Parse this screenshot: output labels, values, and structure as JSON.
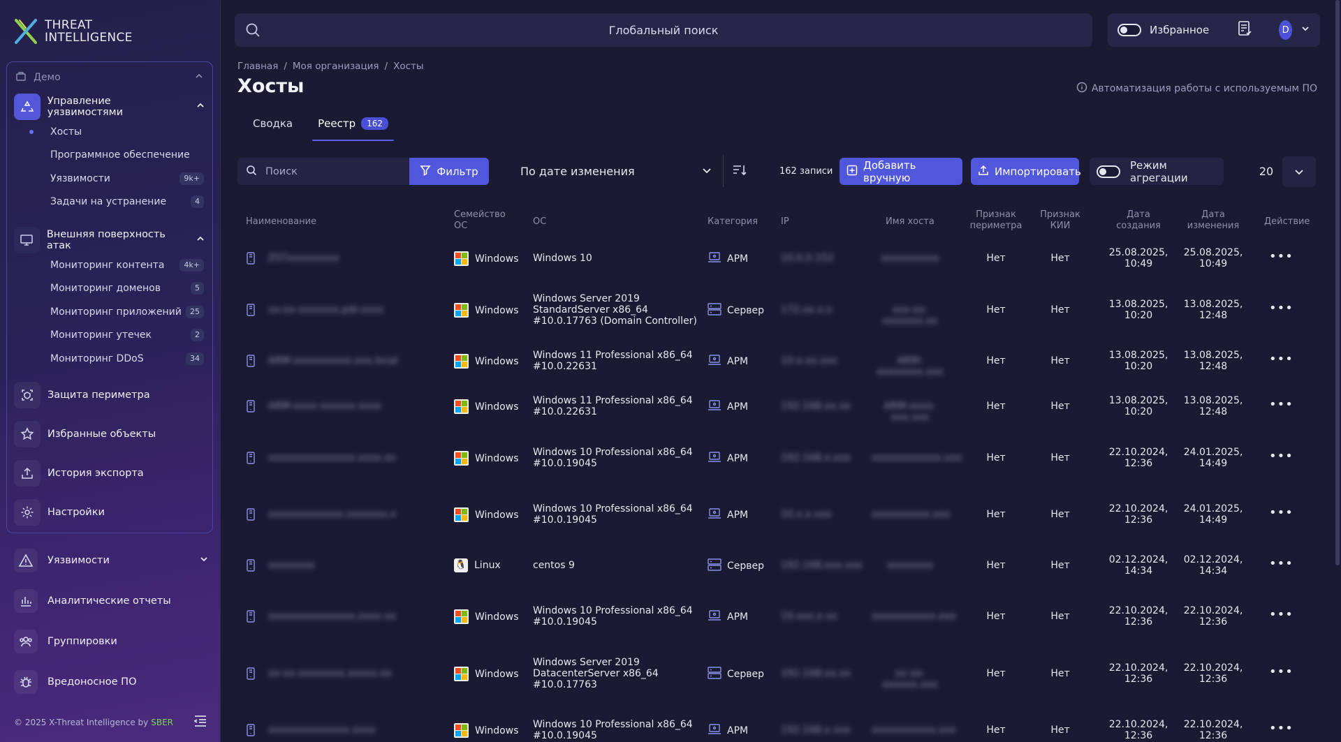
{
  "app": {
    "logo_line1": "THREAT",
    "logo_line2": "INTELLIGENCE",
    "footer_copyright": "© 2025 X-Threat Intelligence by",
    "footer_brand": "SBER"
  },
  "sidebar": {
    "org_label": "Демо",
    "groups": [
      {
        "label": "Управление уязвимостями",
        "items": [
          {
            "label": "Хосты",
            "badge": ""
          },
          {
            "label": "Программное обеспечение",
            "badge": ""
          },
          {
            "label": "Уязвимости",
            "badge": "9k+"
          },
          {
            "label": "Задачи на устранение",
            "badge": "4"
          }
        ]
      },
      {
        "label": "Внешняя поверхность атак",
        "items": [
          {
            "label": "Мониторинг контента",
            "badge": "4k+"
          },
          {
            "label": "Мониторинг доменов",
            "badge": "5"
          },
          {
            "label": "Мониторинг приложений",
            "badge": "25"
          },
          {
            "label": "Мониторинг утечек",
            "badge": "2"
          },
          {
            "label": "Мониторинг DDoS",
            "badge": "34"
          }
        ]
      }
    ],
    "inner_items": [
      "Защита периметра",
      "Избранные объекты",
      "История экспорта",
      "Настройки"
    ],
    "outer_items": [
      "Уязвимости",
      "Аналитические отчеты",
      "Группировки",
      "Вредоносное ПО"
    ]
  },
  "topbar": {
    "global_search": "Глобальный поиск",
    "favorites_label": "Избранное",
    "avatar_letter": "D"
  },
  "page": {
    "breadcrumb": [
      "Главная",
      "/",
      "Моя организация",
      "/",
      "Хосты"
    ],
    "title": "Хосты",
    "automation_link": "Автоматизация работы с используемым ПО",
    "tabs": [
      {
        "label": "Сводка"
      },
      {
        "label": "Реестр",
        "badge": "162"
      }
    ]
  },
  "toolbar": {
    "search_placeholder": "Поиск",
    "filter_label": "Фильтр",
    "sort_label": "По дате изменения",
    "records": "162 записи",
    "add_manual": "Добавить вручную",
    "import": "Импортировать",
    "aggregation": "Режим агрегации",
    "page_size": "20"
  },
  "table": {
    "headers": {
      "name": "Наименование",
      "os_family_1": "Семейство",
      "os_family_2": "ОС",
      "os": "ОС",
      "category": "Категория",
      "ip": "IP",
      "hostname": "Имя хоста",
      "perimeter_1": "Признак",
      "perimeter_2": "периметра",
      "kii_1": "Признак",
      "kii_2": "КИИ",
      "created_1": "Дата",
      "created_2": "создания",
      "modified_1": "Дата",
      "modified_2": "изменения",
      "action": "Действие"
    },
    "rows": [
      {
        "name": "ZSTxxxxxxxxx",
        "os_family": "Windows",
        "os_lines": [
          "Windows 10"
        ],
        "category": "АРМ",
        "ip": "10.0.0.152",
        "hostname": "xxxxxxxxxx",
        "perimeter": "Нет",
        "kii": "Нет",
        "created": [
          "25.08.2025,",
          "10:49"
        ],
        "modified": [
          "25.08.2025,",
          "10:49"
        ]
      },
      {
        "name": "xx-xx-xxxxxxx.pdr.xxxx",
        "os_family": "Windows",
        "os_lines": [
          "Windows Server 2019",
          "StandardServer x86_64",
          "#10.0.17763 (Domain Controller)"
        ],
        "category": "Сервер",
        "ip": "172.xx.x.x",
        "hostname": "xxx-xx-xxxxxxx.xx",
        "perimeter": "Нет",
        "kii": "Нет",
        "created": [
          "13.08.2025,",
          "10:20"
        ],
        "modified": [
          "13.08.2025,",
          "12:48"
        ]
      },
      {
        "name": "ARM-xxxxxxxxxx.xxx.local",
        "os_family": "Windows",
        "os_lines": [
          "Windows 11 Professional x86_64",
          "#10.0.22631"
        ],
        "category": "АРМ",
        "ip": "10.x.xx.xxx",
        "hostname": "ARM-xxxxxxxx.xxx",
        "perimeter": "Нет",
        "kii": "Нет",
        "created": [
          "13.08.2025,",
          "10:20"
        ],
        "modified": [
          "13.08.2025,",
          "12:48"
        ]
      },
      {
        "name": "ARM-xxxx-xxxxxx.xxxx",
        "os_family": "Windows",
        "os_lines": [
          "Windows 11 Professional x86_64",
          "#10.0.22631"
        ],
        "category": "АРМ",
        "ip": "192.168.xx.xx",
        "hostname": "ARM-xxxx-xxx.xxx",
        "perimeter": "Нет",
        "kii": "Нет",
        "created": [
          "13.08.2025,",
          "10:20"
        ],
        "modified": [
          "13.08.2025,",
          "12:48"
        ]
      },
      {
        "name": "xxxxxxxxxxxxxxx.xxxx.xx",
        "os_family": "Windows",
        "os_lines": [
          "Windows 10 Professional x86_64",
          "#10.0.19045"
        ],
        "category": "АРМ",
        "ip": "192.168.x.xxx",
        "hostname": "xxxxxxxxxxxx.xxx",
        "perimeter": "Нет",
        "kii": "Нет",
        "created": [
          "22.10.2024,",
          "12:36"
        ],
        "modified": [
          "24.01.2025,",
          "14:49"
        ]
      },
      {
        "name": "xxxxxxxxxxxxx.xxxxxxx.x",
        "os_family": "Windows",
        "os_lines": [
          "Windows 10 Professional x86_64",
          "#10.0.19045"
        ],
        "category": "АРМ",
        "ip": "10.x.x.xxx",
        "hostname": "xxxxxxxxxx.xxx",
        "perimeter": "Нет",
        "kii": "Нет",
        "created": [
          "22.10.2024,",
          "12:36"
        ],
        "modified": [
          "24.01.2025,",
          "14:49"
        ]
      },
      {
        "name": "xxxxxxxx",
        "os_family": "Linux",
        "os_lines": [
          "centos 9"
        ],
        "category": "Сервер",
        "ip": "192.168.xxx.xxx",
        "hostname": "xxxxxxxx",
        "perimeter": "Нет",
        "kii": "Нет",
        "created": [
          "02.12.2024,",
          "14:34"
        ],
        "modified": [
          "02.12.2024,",
          "14:34"
        ]
      },
      {
        "name": "xxxxxxxxxxxxxxx.xxxx.xx",
        "os_family": "Windows",
        "os_lines": [
          "Windows 10 Professional x86_64",
          "#10.0.19045"
        ],
        "category": "АРМ",
        "ip": "10.xxx.x.xx",
        "hostname": "xxxxxxxxxxx.xxx",
        "perimeter": "Нет",
        "kii": "Нет",
        "created": [
          "22.10.2024,",
          "12:36"
        ],
        "modified": [
          "22.10.2024,",
          "12:36"
        ]
      },
      {
        "name": "xx-xx-xxxxxxxx.xxxxx.xx",
        "os_family": "Windows",
        "os_lines": [
          "Windows Server 2019",
          "DatacenterServer x86_64",
          "#10.0.17763"
        ],
        "category": "Сервер",
        "ip": "192.168.xx.xx",
        "hostname": "xx-xx-xxxxxx.xxx",
        "perimeter": "Нет",
        "kii": "Нет",
        "created": [
          "22.10.2024,",
          "12:36"
        ],
        "modified": [
          "22.10.2024,",
          "12:36"
        ]
      },
      {
        "name": "xxxxxxxxxxxxxx.xxxx",
        "os_family": "Windows",
        "os_lines": [
          "Windows 10 Professional x86_64",
          "#10.0.19045"
        ],
        "category": "АРМ",
        "ip": "192.168.x.xxx",
        "hostname": "xxxxxxxxxxx.xxx",
        "perimeter": "Нет",
        "kii": "Нет",
        "created": [
          "22.10.2024,",
          "12:36"
        ],
        "modified": [
          "22.10.2024,",
          "12:36"
        ]
      }
    ]
  }
}
